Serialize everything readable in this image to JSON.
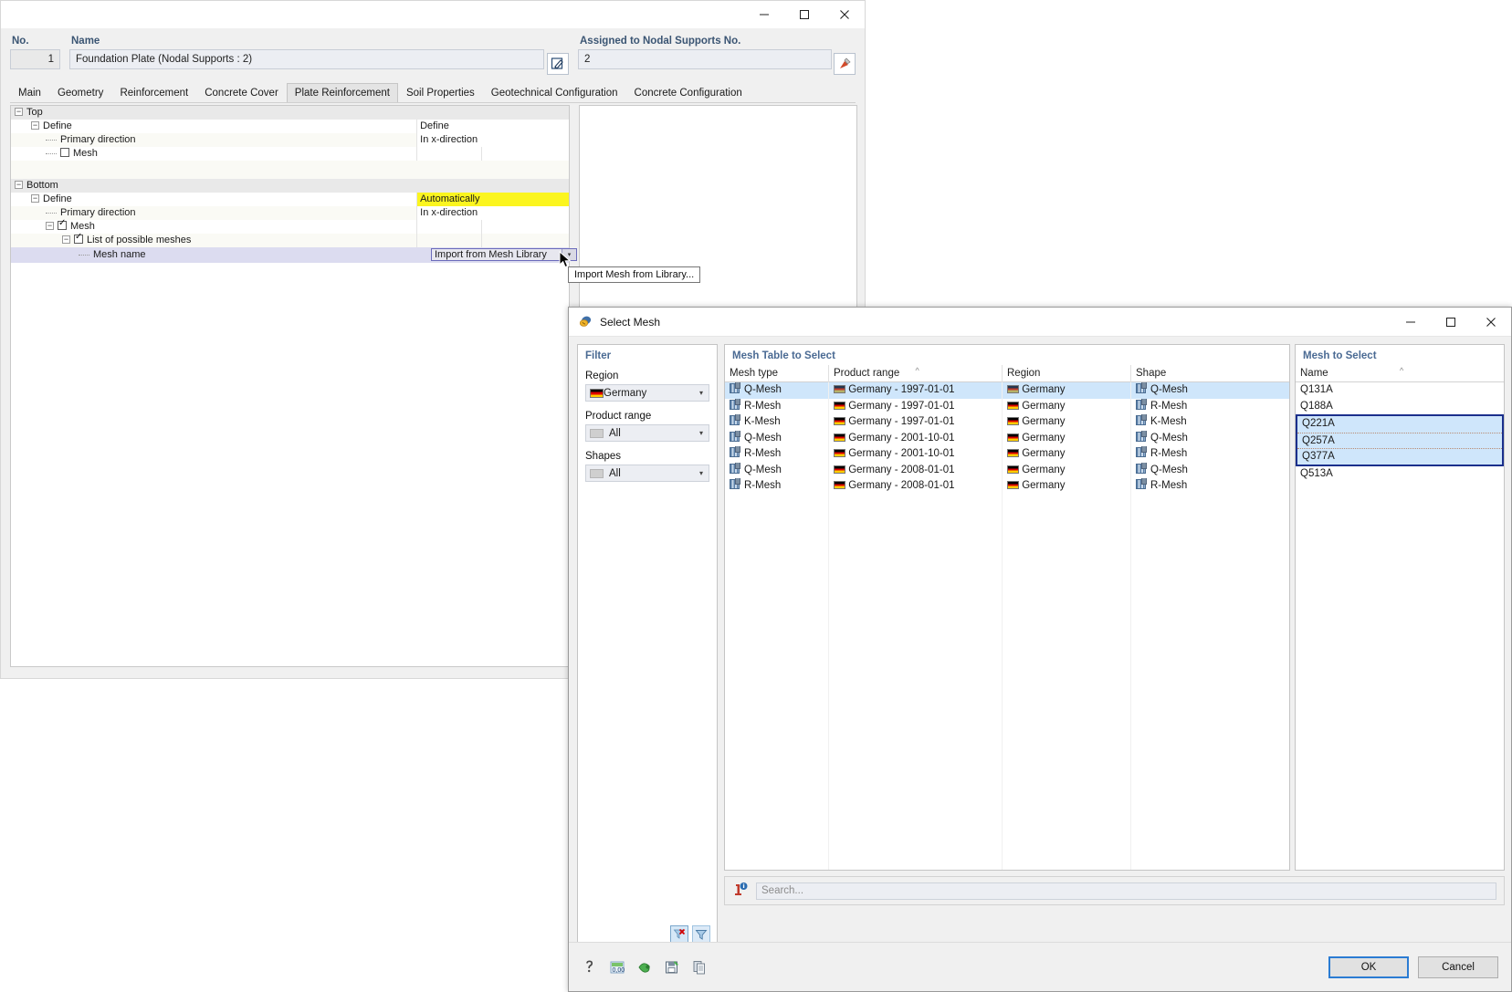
{
  "back_window": {
    "title_buttons": {
      "minimize": "—",
      "maximize": "☐",
      "close": "✕"
    },
    "fields": {
      "no_label": "No.",
      "no_value": "1",
      "name_label": "Name",
      "name_value": "Foundation Plate (Nodal Supports : 2)",
      "edit_icon": "edit-pencil-icon",
      "assigned_label": "Assigned to Nodal Supports No.",
      "assigned_value": "2",
      "pick_icon": "pick-tool-icon"
    },
    "tabs": [
      {
        "label": "Main",
        "active": false
      },
      {
        "label": "Geometry",
        "active": false
      },
      {
        "label": "Reinforcement",
        "active": false
      },
      {
        "label": "Concrete Cover",
        "active": false
      },
      {
        "label": "Plate Reinforcement",
        "active": true
      },
      {
        "label": "Soil Properties",
        "active": false
      },
      {
        "label": "Geotechnical Configuration",
        "active": false
      },
      {
        "label": "Concrete Configuration",
        "active": false
      }
    ],
    "tree": {
      "top_group": "Top",
      "bottom_group": "Bottom",
      "rows": [
        {
          "label": "Define",
          "value": "Define"
        },
        {
          "label": "Primary direction",
          "value": "In x-direction"
        },
        {
          "label": "Mesh",
          "value": ""
        },
        {
          "label": "Define",
          "value": "Automatically"
        },
        {
          "label": "Primary direction",
          "value": "In x-direction"
        },
        {
          "label": "Mesh",
          "value": ""
        },
        {
          "label": "List of possible meshes",
          "value": ""
        },
        {
          "label": "Mesh name",
          "value": "Import from Mesh Library"
        }
      ]
    },
    "tooltip": "Import Mesh from Library..."
  },
  "dialog": {
    "title": "Select Mesh",
    "title_icon": "mesh-roll-icon",
    "title_buttons": {
      "minimize": "—",
      "maximize": "☐",
      "close": "✕"
    },
    "filter": {
      "heading": "Filter",
      "region_label": "Region",
      "region_value": "Germany",
      "region_icon": "germany-flag-icon",
      "product_range_label": "Product range",
      "product_range_value": "All",
      "shapes_label": "Shapes",
      "shapes_value": "All",
      "clear_filter_icon": "clear-filter-icon",
      "apply_filter_icon": "filter-funnel-icon"
    },
    "mesh_table": {
      "heading": "Mesh Table to Select",
      "columns": [
        "Mesh type",
        "Product range",
        "Region",
        "Shape"
      ],
      "sorted_column": "Product range",
      "sort_caret": "^",
      "rows": [
        {
          "mesh_type": "Q-Mesh",
          "product_range": "Germany - 1997-01-01",
          "region": "Germany",
          "shape": "Q-Mesh",
          "selected": true
        },
        {
          "mesh_type": "R-Mesh",
          "product_range": "Germany - 1997-01-01",
          "region": "Germany",
          "shape": "R-Mesh",
          "selected": false
        },
        {
          "mesh_type": "K-Mesh",
          "product_range": "Germany - 1997-01-01",
          "region": "Germany",
          "shape": "K-Mesh",
          "selected": false
        },
        {
          "mesh_type": "Q-Mesh",
          "product_range": "Germany - 2001-10-01",
          "region": "Germany",
          "shape": "Q-Mesh",
          "selected": false
        },
        {
          "mesh_type": "R-Mesh",
          "product_range": "Germany - 2001-10-01",
          "region": "Germany",
          "shape": "R-Mesh",
          "selected": false
        },
        {
          "mesh_type": "Q-Mesh",
          "product_range": "Germany - 2008-01-01",
          "region": "Germany",
          "shape": "Q-Mesh",
          "selected": false
        },
        {
          "mesh_type": "R-Mesh",
          "product_range": "Germany - 2008-01-01",
          "region": "Germany",
          "shape": "R-Mesh",
          "selected": false
        }
      ]
    },
    "mesh_to_select": {
      "heading": "Mesh to Select",
      "column": "Name",
      "sort_caret": "^",
      "rows": [
        {
          "name": "Q131A",
          "selected": false
        },
        {
          "name": "Q188A",
          "selected": false
        },
        {
          "name": "Q221A",
          "selected": true
        },
        {
          "name": "Q257A",
          "selected": true
        },
        {
          "name": "Q377A",
          "selected": true
        },
        {
          "name": "Q513A",
          "selected": false
        }
      ]
    },
    "search": {
      "icon": "info-search-icon",
      "placeholder": "Search..."
    },
    "footer": {
      "icons": [
        "help-icon",
        "units-icon",
        "settings-icon",
        "save-config-icon",
        "copy-icon"
      ],
      "ok_label": "OK",
      "cancel_label": "Cancel"
    }
  },
  "colors": {
    "accent_blue": "#2b7cd3",
    "selection_blue": "#cfe6fb",
    "highlight_yellow": "#fbf51f",
    "selected_row_border": "#1b2f8c",
    "header_label": "#3b5573"
  }
}
